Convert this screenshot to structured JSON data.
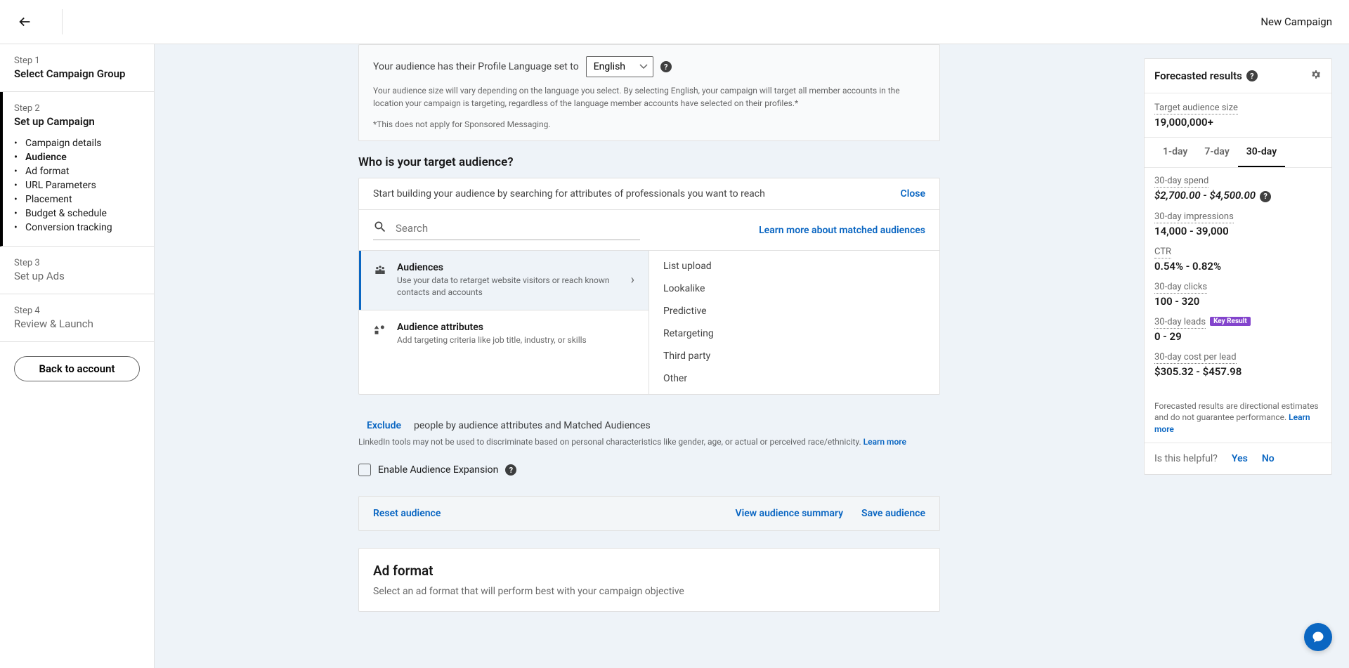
{
  "header": {
    "title": "New Campaign"
  },
  "sidebar": {
    "step1": {
      "num": "Step 1",
      "title": "Select Campaign Group"
    },
    "step2": {
      "num": "Step 2",
      "title": "Set up Campaign",
      "items": [
        "Campaign details",
        "Audience",
        "Ad format",
        "URL Parameters",
        "Placement",
        "Budget & schedule",
        "Conversion tracking"
      ]
    },
    "step3": {
      "num": "Step 3",
      "title": "Set up Ads"
    },
    "step4": {
      "num": "Step 4",
      "title": "Review & Launch"
    },
    "back_btn": "Back to account"
  },
  "lang": {
    "prefix": "Your audience has their Profile Language set to",
    "selected": "English",
    "note": "Your audience size will vary depending on the language you select. By selecting English, your campaign will target all member accounts in the location your campaign is targeting, regardless of the language member accounts have selected on their profiles.*",
    "note2": "*This does not apply for Sponsored Messaging."
  },
  "audience": {
    "heading": "Who is your target audience?",
    "build_text": "Start building your audience by searching for attributes of professionals you want to reach",
    "close": "Close",
    "search_ph": "Search",
    "learn_matched": "Learn more about matched audiences",
    "items": [
      {
        "title": "Audiences",
        "desc": "Use your data to retarget website visitors or reach known contacts and accounts"
      },
      {
        "title": "Audience attributes",
        "desc": "Add targeting criteria like job title, industry, or skills"
      }
    ],
    "subitems": [
      "List upload",
      "Lookalike",
      "Predictive",
      "Retargeting",
      "Third party",
      "Other"
    ],
    "exclude": "Exclude",
    "exclude_text": "people by audience attributes and Matched Audiences",
    "discrim": "LinkedIn tools may not be used to discriminate based on personal characteristics like gender, age, or actual or perceived race/ethnicity.",
    "discrim_link": "Learn more",
    "expansion": "Enable Audience Expansion",
    "reset": "Reset audience",
    "summary": "View audience summary",
    "save": "Save audience"
  },
  "adformat": {
    "heading": "Ad format",
    "sub": "Select an ad format that will perform best with your campaign objective"
  },
  "forecast": {
    "title": "Forecasted results",
    "size_label": "Target audience size",
    "size_value": "19,000,000+",
    "tabs": [
      "1-day",
      "7-day",
      "30-day"
    ],
    "metrics": [
      {
        "label": "30-day spend",
        "value": "$2,700.00 - $4,500.00",
        "help": true,
        "italic": true
      },
      {
        "label": "30-day impressions",
        "value": "14,000 - 39,000"
      },
      {
        "label": "CTR",
        "value": "0.54% - 0.82%"
      },
      {
        "label": "30-day clicks",
        "value": "100 - 320"
      },
      {
        "label": "30-day leads",
        "value": "0 - 29",
        "badge": "Key Result"
      },
      {
        "label": "30-day cost per lead",
        "value": "$305.32 - $457.98"
      }
    ],
    "disclaimer": "Forecasted results are directional estimates and do not guarantee performance.",
    "disc_link": "Learn more",
    "helpful": "Is this helpful?",
    "yes": "Yes",
    "no": "No"
  }
}
